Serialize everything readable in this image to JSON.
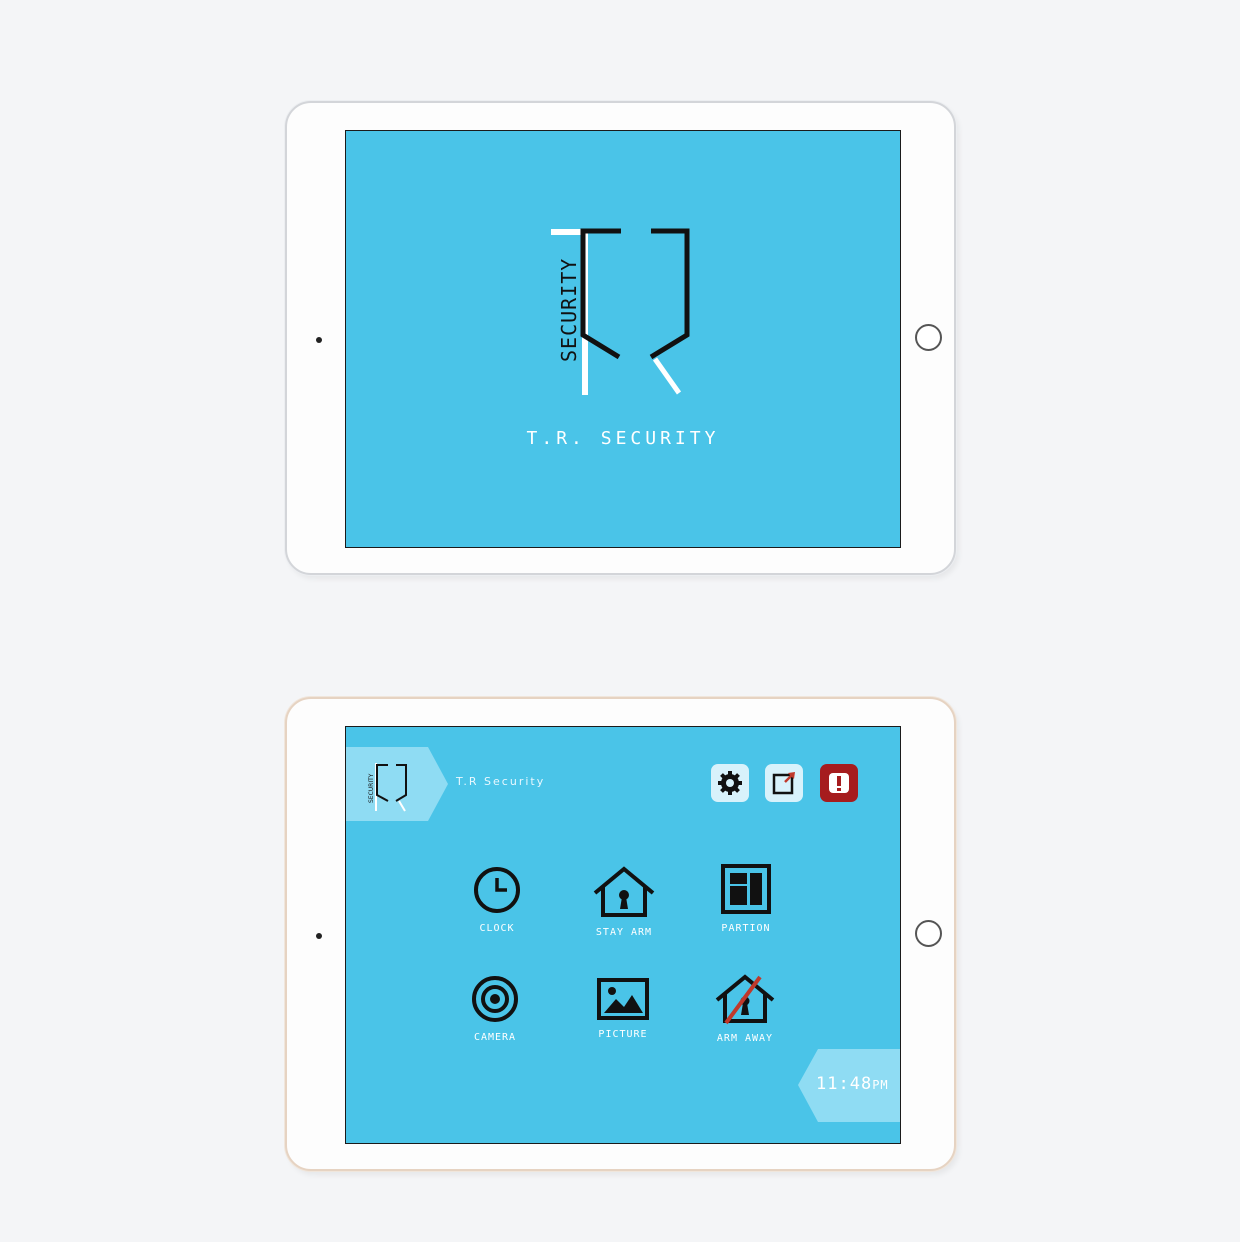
{
  "splash": {
    "logo_word": "SECURITY",
    "title": "T.R. SECURITY"
  },
  "dashboard": {
    "brand": {
      "logo_word": "SECURITY",
      "name": "T.R Security"
    },
    "top_actions": [
      {
        "icon": "gear-icon"
      },
      {
        "icon": "external-link-icon"
      },
      {
        "icon": "alert-icon"
      }
    ],
    "tiles": [
      {
        "label": "CLOCK",
        "icon": "clock-icon"
      },
      {
        "label": "STAY ARM",
        "icon": "house-lock-icon"
      },
      {
        "label": "PARTION",
        "icon": "partition-icon"
      },
      {
        "label": "CAMERA",
        "icon": "camera-icon"
      },
      {
        "label": "PICTURE",
        "icon": "picture-icon"
      },
      {
        "label": "ARM AWAY",
        "icon": "house-crossed-icon"
      }
    ],
    "clock": {
      "time": "11:48",
      "meridiem": "PM"
    }
  },
  "colors": {
    "screen": "#4ac4e8",
    "alert": "#a61c1e",
    "icon_bg": "#d8f2fb"
  }
}
